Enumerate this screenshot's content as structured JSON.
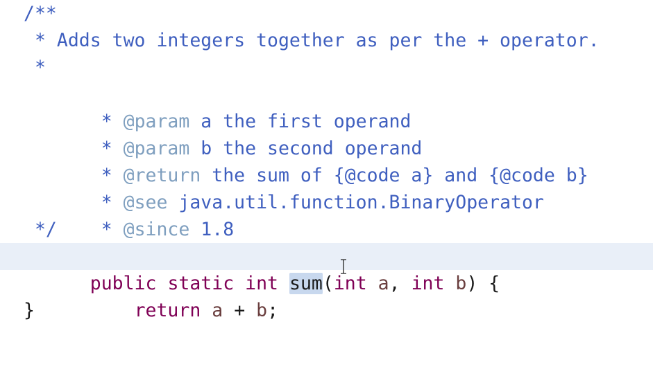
{
  "colors": {
    "javadoc": "#3f5fbf",
    "javadoc_tag": "#7f9fbf",
    "keyword": "#7f0055",
    "parameter": "#6a3e3e",
    "current_line_highlight": "#e9eff8",
    "selection": "#c8d8ee"
  },
  "lines": [
    {
      "segments": [
        "/**"
      ]
    },
    {
      "segments": [
        " * Adds two integers together as per the + operator."
      ]
    },
    {
      "segments": [
        " *"
      ]
    },
    {
      "segments": [
        " * ",
        "@param",
        " a the first operand"
      ]
    },
    {
      "segments": [
        " * ",
        "@param",
        " b the second operand"
      ]
    },
    {
      "segments": [
        " * ",
        "@return",
        " the sum of {@code a} and {@code b}"
      ]
    },
    {
      "segments": [
        " * ",
        "@see",
        " java.util.function.BinaryOperator"
      ]
    },
    {
      "segments": [
        " * ",
        "@since",
        " 1.8"
      ]
    },
    {
      "segments": [
        " */"
      ]
    },
    {
      "segments": [
        "public",
        " ",
        "static",
        " ",
        "int",
        " ",
        "sum",
        "(",
        "int",
        " ",
        "a",
        ", ",
        "int",
        " ",
        "b",
        ") {"
      ]
    },
    {
      "segments": [
        "    ",
        "return",
        " ",
        "a",
        " + ",
        "b",
        ";"
      ]
    },
    {
      "segments": [
        "}"
      ]
    }
  ],
  "cursor_icon": "text-cursor-icon"
}
